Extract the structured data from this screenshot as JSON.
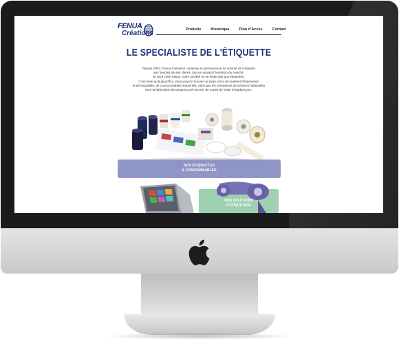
{
  "site": {
    "logo_top": "FENUA",
    "logo_bottom": "Créations"
  },
  "nav": {
    "items": [
      "Produits",
      "Historique",
      "Plan d'Accès",
      "Contact"
    ]
  },
  "headline": "LE SPECIALISTE DE L'ÉTIQUETTE",
  "intro": {
    "lines": [
      "Depuis 2002, Fenua Créations conserve en permanence sa volonté de s'adapter",
      "aux besoins de ses clients, tout en suivant l'évolution du marché.",
      "Et pour cette raison, notre société ne se limite pas aux étiquettes.",
      "C'est ainsi qu'aujourd'hui, vous pouvez trouver un large choix de matériel d'impression",
      "et de traçabilité, de consommables industriels, ainsi que les prestations de services habituelles",
      "dont la fabrication de tampons pré-encrés, de cartes de visite et badges pvc."
    ]
  },
  "banners": {
    "labels_line1": "NOS ÉTIQUETTES",
    "labels_line2": "& CONSOMMABLES",
    "solutions_line1": "NOS SOLUTIONS",
    "solutions_line2": "D'ÉTIQUETAGE"
  },
  "colors": {
    "brand_blue": "#1f2f7a",
    "banner_purple": "#8a90c4",
    "solutions_green": "#9fd0b0",
    "bezel": "#1b1b1b"
  },
  "icons": {
    "apple": "apple-logo-icon"
  }
}
